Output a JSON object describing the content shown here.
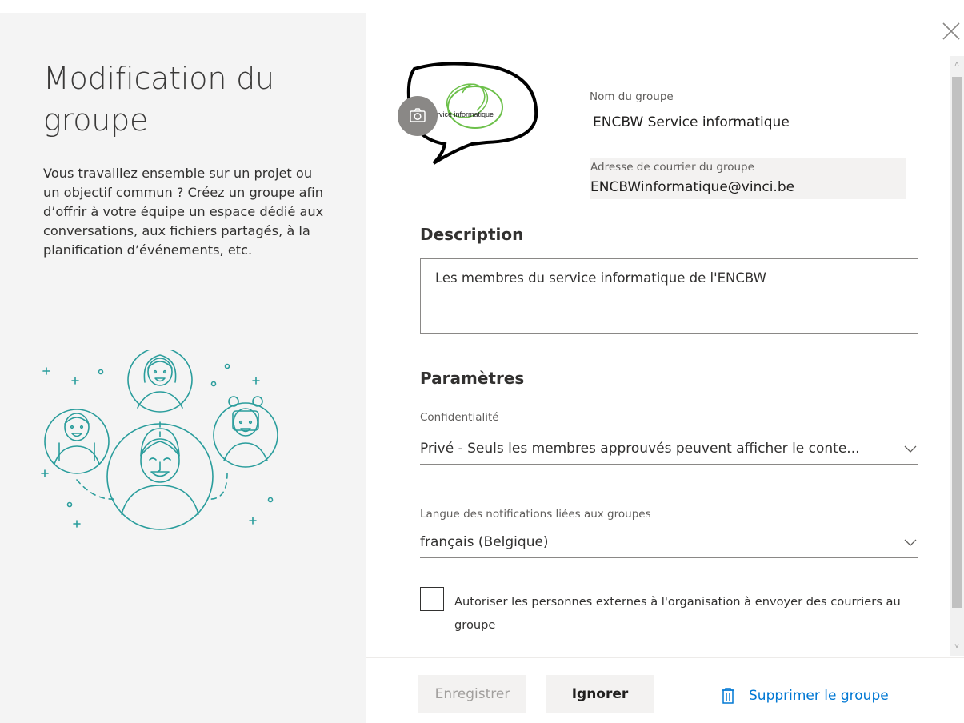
{
  "dialog": {
    "title": "Modification du groupe",
    "intro": "Vous travaillez ensemble sur un projet ou un objectif commun ? Créez un groupe afin d’offrir à votre équipe un espace dédié aux conversations, aux fichiers partagés, à la planification d’événements, etc."
  },
  "photo": {
    "logo_text": "rvice informatique",
    "camera_icon": "camera-icon"
  },
  "group_name": {
    "label": "Nom du groupe",
    "value": "ENCBW Service informatique"
  },
  "group_email": {
    "label": "Adresse de courrier du groupe",
    "value": "ENCBWinformatique@vinci.be"
  },
  "description": {
    "heading": "Description",
    "value": "Les membres du service informatique de l'ENCBW"
  },
  "settings": {
    "heading": "Paramètres",
    "privacy_label": "Confidentialité",
    "privacy_value": "Privé - Seuls les membres approuvés peuvent afficher le conte...",
    "language_label": "Langue des notifications liées aux groupes",
    "language_value": "français (Belgique)",
    "external_label": "Autoriser les personnes externes à l'organisation à envoyer des courriers au groupe",
    "external_checked": false
  },
  "footer": {
    "save_label": "Enregistrer",
    "ignore_label": "Ignorer",
    "delete_label": "Supprimer le groupe"
  },
  "colors": {
    "accent": "#0078d4",
    "illustration": "#2a9d9c",
    "left_panel_bg": "#f4f4f4"
  }
}
